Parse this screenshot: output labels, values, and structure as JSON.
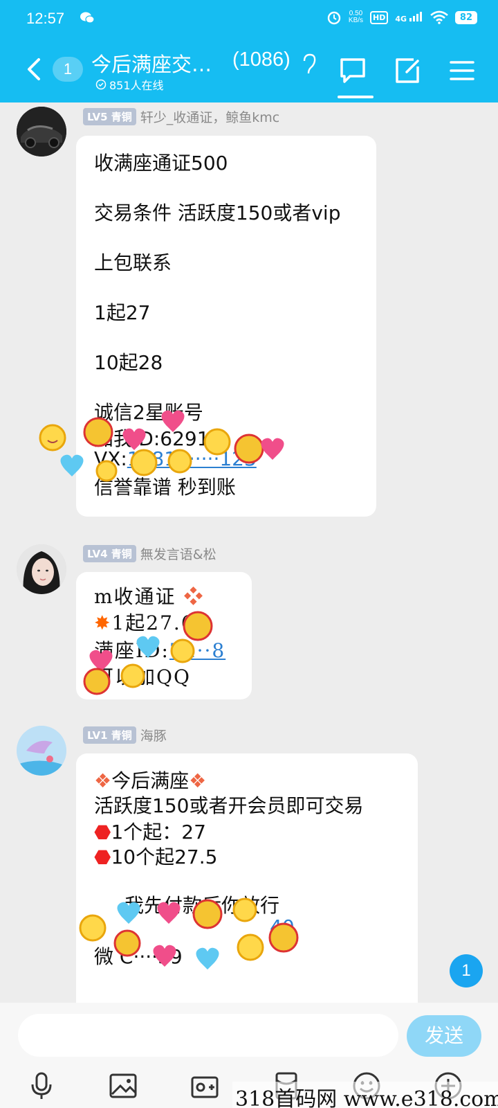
{
  "status": {
    "time": "12:57",
    "net_speed": "0.50",
    "net_unit": "KB/s",
    "hd": "HD",
    "signal": "4G",
    "battery": "82"
  },
  "header": {
    "unread": "1",
    "title": "今后满座交…",
    "member_count": "(1086)",
    "online": "851人在线"
  },
  "messages": [
    {
      "level": "LV5 青铜",
      "sender": "轩少_收通证，鲸鱼kmc",
      "lines": [
        "收满座通证500",
        "交易条件 活跃度150或者vip",
        "上包联系",
        "1起27",
        "10起28",
        "诚信2星账号"
      ],
      "line_id_label": "ID:",
      "line_id_prefix": "加我",
      "line_id_value": "6291",
      "line_vx_label": "VX:",
      "line_vx_value": "15814·····123",
      "line_last": "信誉靠谱 秒到账"
    },
    {
      "level": "LV4 青铜",
      "sender": "無发言语&松",
      "lines": [
        "m收通证",
        "1起27.6"
      ],
      "line_id_label": "满座ID:",
      "line_id_value": "74··8",
      "line_last": "可以加QQ"
    },
    {
      "level": "LV1 青铜",
      "sender": "海豚",
      "lines": [
        "今后满座",
        "活跃度150或者开会员即可交易",
        "1个起：27",
        "10个起27.5"
      ],
      "line_pay": "我先付款后你放行",
      "line_id_value": "40",
      "line_wx_prefix": "微",
      "line_wx_value": "C····59"
    }
  ],
  "floating_badge": "1",
  "input": {
    "placeholder": "",
    "send_label": "发送"
  },
  "toolbar": [
    "voice-icon",
    "image-icon",
    "camera-icon",
    "red-packet-icon",
    "emoji-icon",
    "plus-icon"
  ],
  "watermark": "318首码网 www.e318.com",
  "colors": {
    "header_bg": "#16bdf2",
    "send_btn": "#8fd7f7",
    "level_badge": "#b8c2d4",
    "link": "#2b7fd1"
  }
}
